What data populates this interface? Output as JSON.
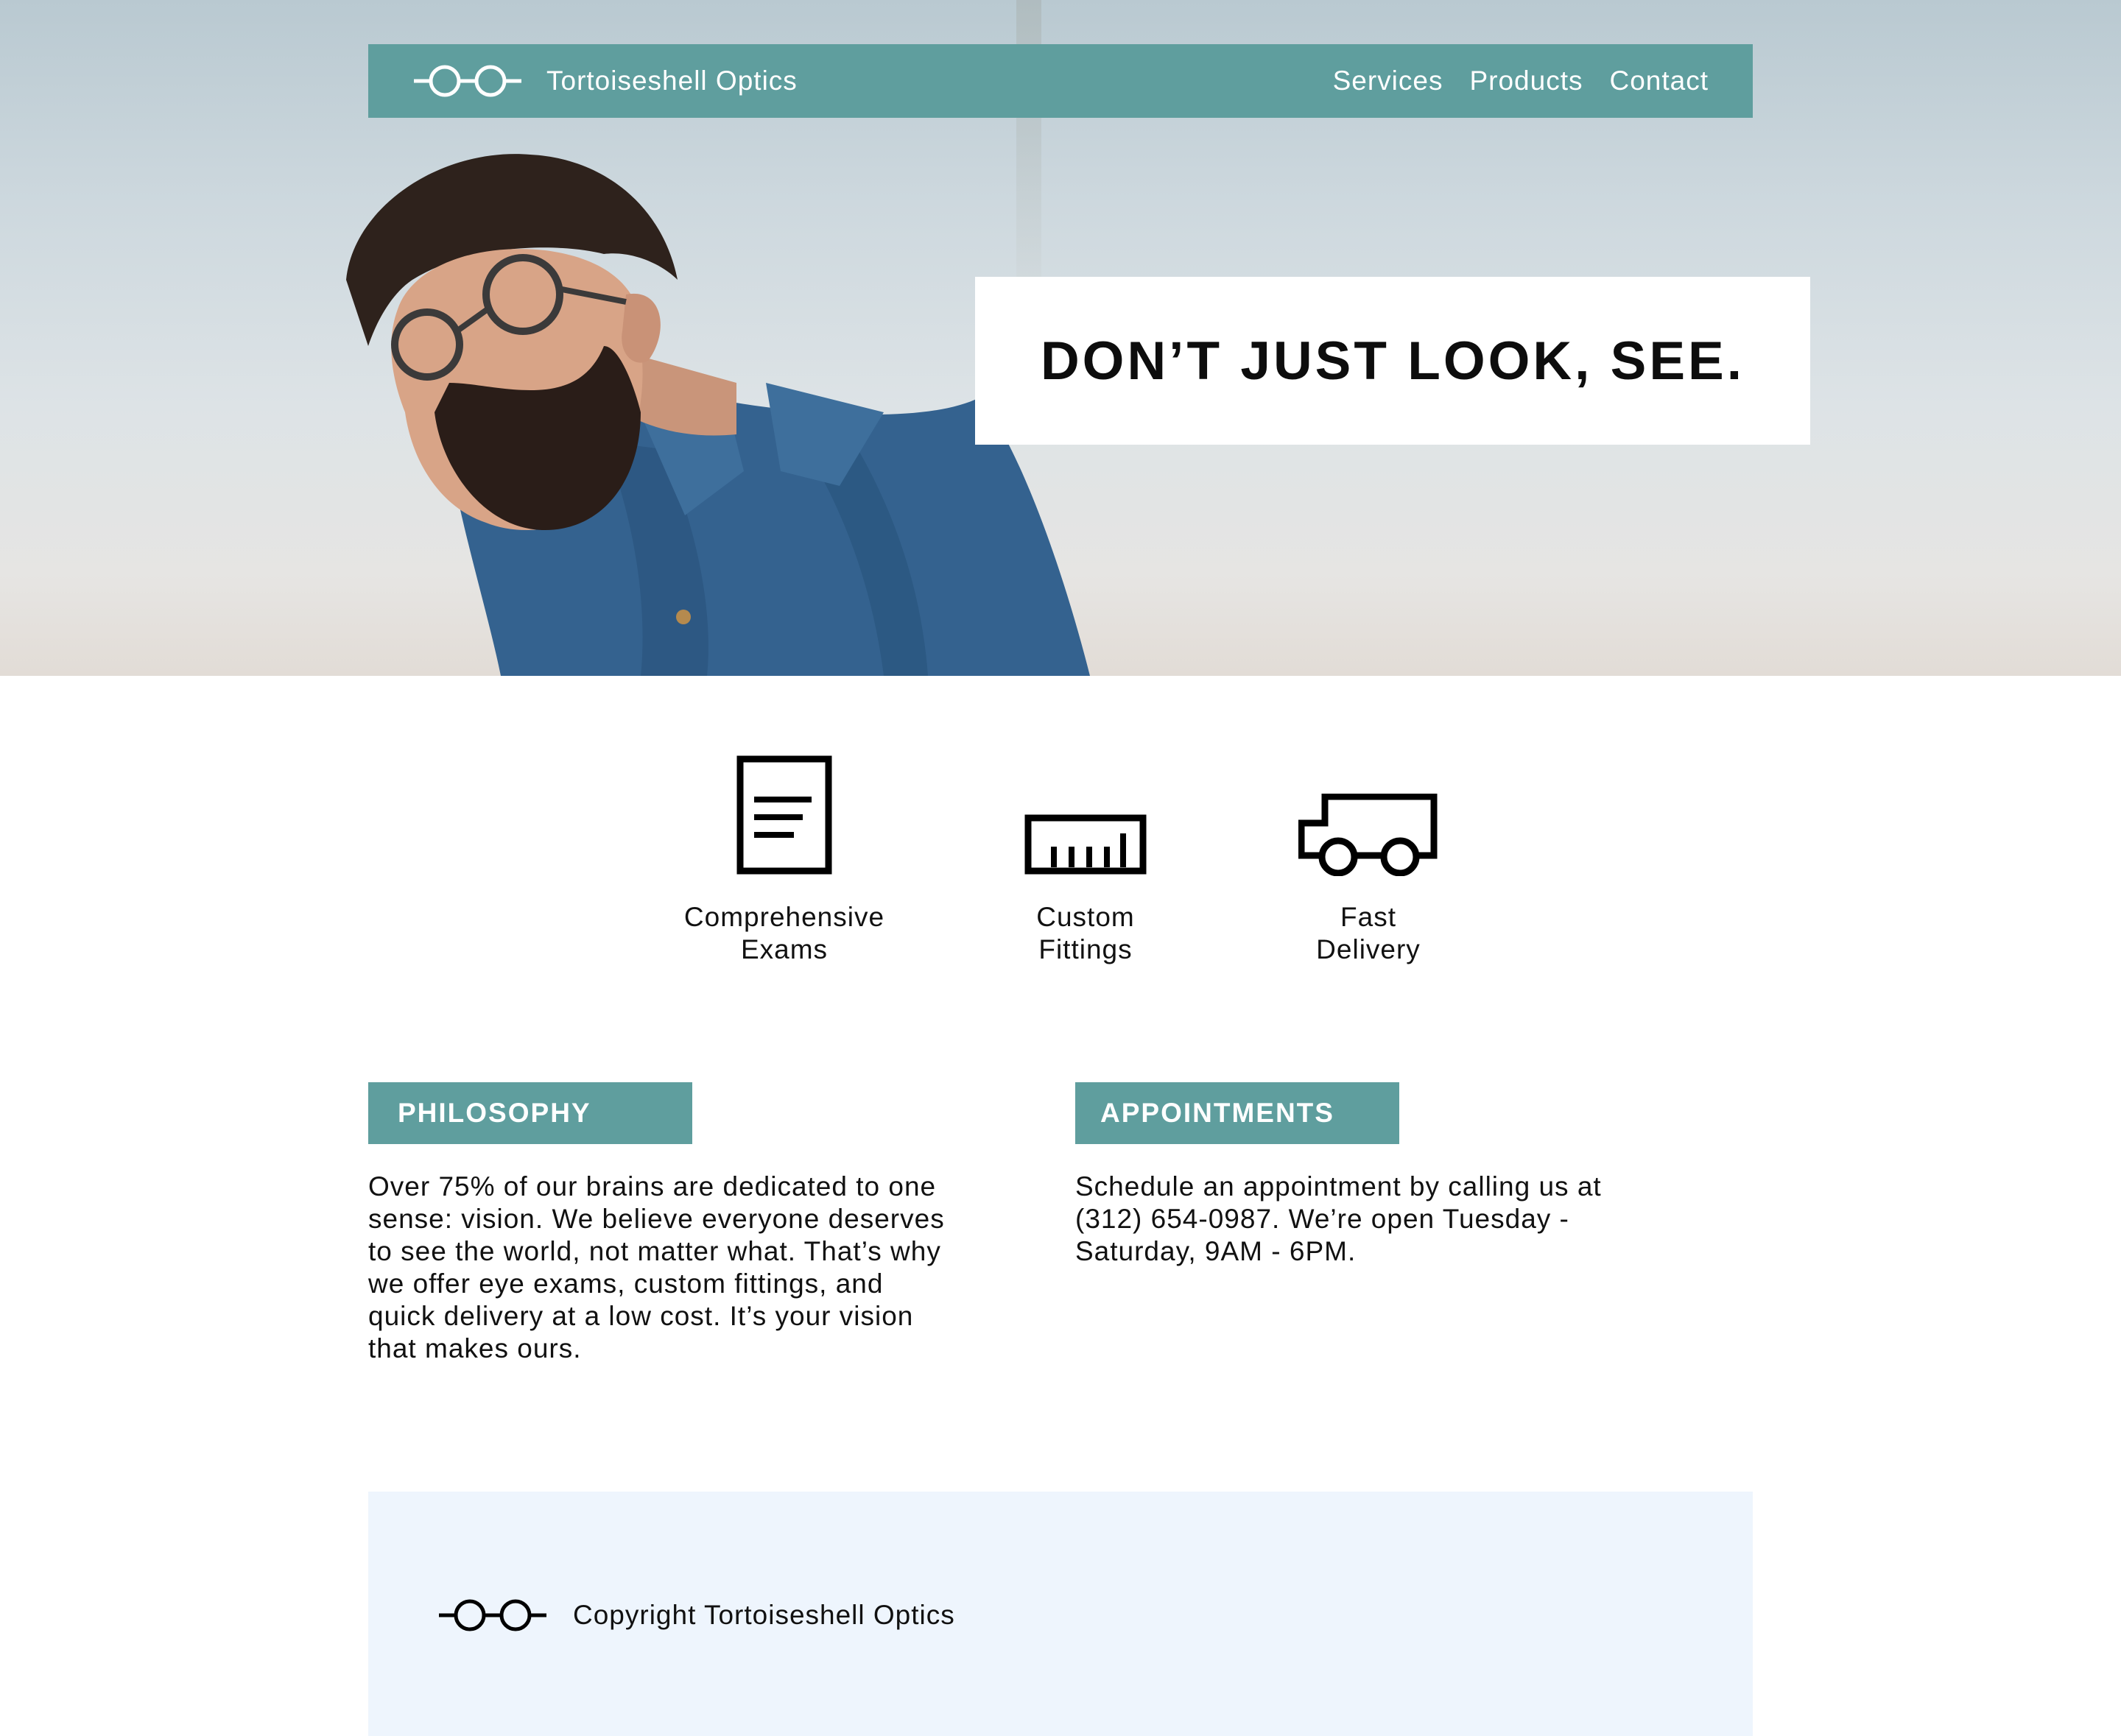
{
  "brand": {
    "name": "Tortoiseshell Optics",
    "logo_icon": "glasses-icon"
  },
  "nav": {
    "items": [
      {
        "label": "Services"
      },
      {
        "label": "Products"
      },
      {
        "label": "Contact"
      }
    ]
  },
  "hero": {
    "headline": "DON’T JUST LOOK, SEE.",
    "image": "man-with-glasses-photo"
  },
  "features": [
    {
      "icon": "document-icon",
      "line1": "Comprehensive",
      "line2": "Exams"
    },
    {
      "icon": "ruler-icon",
      "line1": "Custom",
      "line2": "Fittings"
    },
    {
      "icon": "truck-icon",
      "line1": "Fast",
      "line2": "Delivery"
    }
  ],
  "philosophy": {
    "title": "PHILOSOPHY",
    "lines": [
      "Over 75% of our brains are dedicated to one",
      "sense: vision. We believe everyone deserves",
      "to see the world, not matter what. That’s why",
      "we offer eye exams, custom fittings, and",
      "quick delivery at a low cost. It’s your vision",
      "that makes ours."
    ]
  },
  "appointments": {
    "title": "APPOINTMENTS",
    "lines": [
      "Schedule an appointment by calling us at",
      "(312) 654-0987. We’re open Tuesday -",
      "Saturday, 9AM - 6PM."
    ]
  },
  "footer": {
    "text": "Copyright Tortoiseshell Optics",
    "logo_icon": "glasses-icon"
  },
  "colors": {
    "accent": "#5f9e9e",
    "footer_bg": "#eef5fd",
    "text": "#111111"
  }
}
